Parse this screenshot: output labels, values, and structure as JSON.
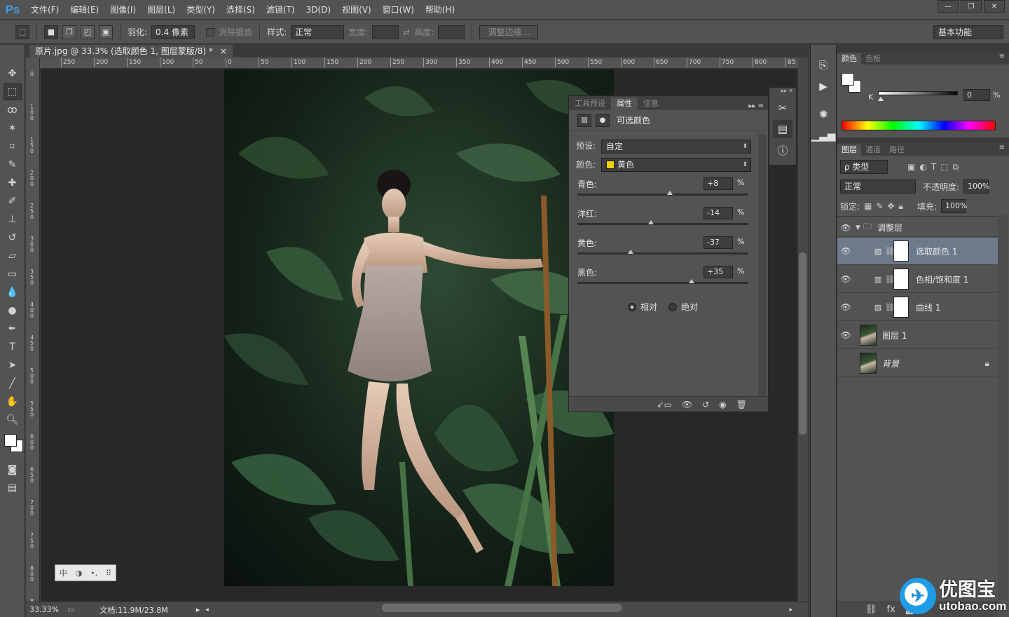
{
  "app": {
    "logo": "Ps"
  },
  "menu": [
    "文件(F)",
    "编辑(E)",
    "图像(I)",
    "图层(L)",
    "类型(Y)",
    "选择(S)",
    "滤镜(T)",
    "3D(D)",
    "视图(V)",
    "窗口(W)",
    "帮助(H)"
  ],
  "window_buttons": {
    "minimize": "—",
    "restore": "❐",
    "close": "✕"
  },
  "options": {
    "feather_label": "羽化:",
    "feather_value": "0.4 像素",
    "antialias_label": "消除锯齿",
    "style_label": "样式:",
    "style_value": "正常",
    "width_label": "宽度:",
    "height_label": "高度:",
    "refine_edge": "调整边缘...",
    "workspace": "基本功能"
  },
  "document": {
    "tab_title": "原片.jpg @ 33.3% (选取颜色 1, 图层蒙版/8) *",
    "close": "×",
    "zoom": "33.33%",
    "doc_size": "文档:11.9M/23.8M"
  },
  "ruler": {
    "h": [
      "250",
      "200",
      "150",
      "100",
      "50",
      "0",
      "50",
      "100",
      "150",
      "200",
      "250",
      "300",
      "350",
      "400",
      "450",
      "500",
      "550",
      "600",
      "650",
      "700",
      "750",
      "800",
      "85"
    ],
    "v": [
      "0",
      "100",
      "150",
      "200",
      "250",
      "300",
      "350",
      "400",
      "450",
      "500",
      "550",
      "600",
      "650",
      "700",
      "750",
      "800",
      "850"
    ]
  },
  "properties": {
    "tabs": [
      "工具预设",
      "属性",
      "信息"
    ],
    "active_tab": 1,
    "title": "可选颜色",
    "preset_label": "预设:",
    "preset_value": "自定",
    "color_label": "颜色:",
    "color_value": "黄色",
    "color_swatch": "#f5d000",
    "sliders": [
      {
        "label": "青色:",
        "value": "+8",
        "unit": "%",
        "pos": 0.54
      },
      {
        "label": "洋红:",
        "value": "-14",
        "unit": "%",
        "pos": 0.43
      },
      {
        "label": "黄色:",
        "value": "-37",
        "unit": "%",
        "pos": 0.31
      },
      {
        "label": "黑色:",
        "value": "+35",
        "unit": "%",
        "pos": 0.67
      }
    ],
    "method_relative": "相对",
    "method_absolute": "绝对",
    "method_selected": "相对"
  },
  "color_panel": {
    "tabs": [
      "颜色",
      "色板"
    ],
    "channel_label": "K",
    "channel_value": "0",
    "unit": "%"
  },
  "layers_panel": {
    "tabs": [
      "图层",
      "通道",
      "路径"
    ],
    "filter_label": "ρ 类型",
    "blend_mode": "正常",
    "opacity_label": "不透明度:",
    "opacity_value": "100%",
    "lock_label": "锁定:",
    "fill_label": "填充:",
    "fill_value": "100%",
    "layers": [
      {
        "name": "调整层",
        "kind": "group"
      },
      {
        "name": "选取颜色 1",
        "kind": "adjust",
        "icon": "selective-color-icon",
        "selected": true
      },
      {
        "name": "色相/饱和度 1",
        "kind": "adjust",
        "icon": "hue-saturation-icon"
      },
      {
        "name": "曲线 1",
        "kind": "adjust",
        "icon": "curves-icon"
      },
      {
        "name": "图层 1",
        "kind": "pixel"
      },
      {
        "name": "背景",
        "kind": "background",
        "locked": true
      }
    ]
  },
  "watermark": {
    "name": "优图宝",
    "url": "utobao.com"
  }
}
